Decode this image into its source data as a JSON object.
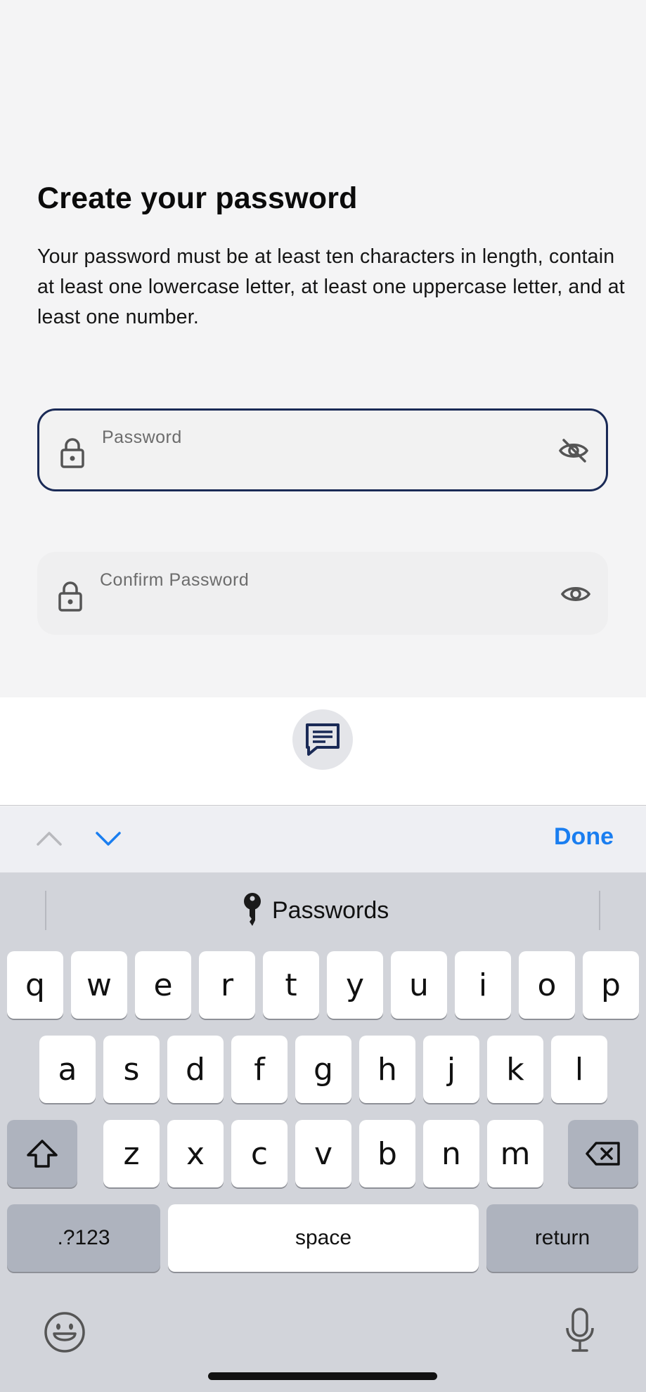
{
  "form": {
    "title": "Create your password",
    "description": "Your password must be at least ten characters in length, contain at least one lowercase letter, at least one uppercase letter, and at least one number.",
    "password_label": "Password",
    "confirm_label": "Confirm Password"
  },
  "accessory_bar": {
    "done_label": "Done"
  },
  "keyboard": {
    "suggestion": "Passwords",
    "row1": [
      "q",
      "w",
      "e",
      "r",
      "t",
      "y",
      "u",
      "i",
      "o",
      "p"
    ],
    "row2": [
      "a",
      "s",
      "d",
      "f",
      "g",
      "h",
      "j",
      "k",
      "l"
    ],
    "row3": [
      "z",
      "x",
      "c",
      "v",
      "b",
      "n",
      "m"
    ],
    "numbers_label": ".?123",
    "space_label": "space",
    "return_label": "return"
  },
  "icons": {
    "lock": "lock-icon",
    "eye_hidden": "eye-slash-icon",
    "eye": "eye-icon",
    "chat": "chat-icon",
    "key": "key-icon",
    "shift": "shift-icon",
    "delete": "delete-icon",
    "emoji": "emoji-icon",
    "mic": "microphone-icon"
  },
  "colors": {
    "accent": "#1a7ef0",
    "focus_border": "#1a2a56",
    "keyboard_bg": "#d2d4da"
  }
}
